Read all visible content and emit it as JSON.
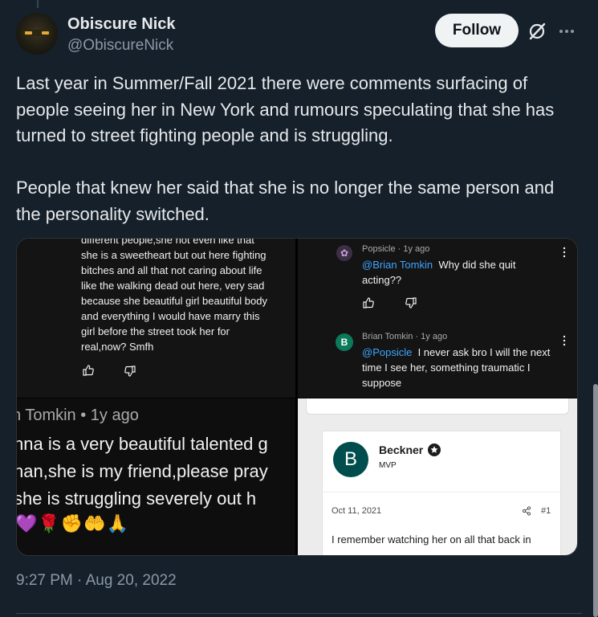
{
  "author": {
    "display_name": "Obiscure Nick",
    "handle": "@ObiscureNick",
    "avatar_icon": "masked-face-avatar"
  },
  "actions": {
    "follow_label": "Follow",
    "grok_icon": "grok-slash-icon",
    "more_icon": "more-dots-icon"
  },
  "tweet": {
    "text": "Last year in Summer/Fall 2021 there were comments surfacing of people seeing her in New York and rumours speculating that she has turned to street fighting people and is struggling.\n\nPeople that knew her said that she is no longer the same person and the personality switched.",
    "timestamp": "9:27 PM · Aug 20, 2022"
  },
  "media": {
    "top_left": {
      "comment_text": "different people,she not even like that\nshe is a sweetheart but out here fighting\nbitches and all that not caring about life\nlike the walking dead out here, very sad\nbecause she beautiful girl beautiful body\nand everything I would have marry this\ngirl before the street took her for\nreal,now? Smfh"
    },
    "top_right": {
      "c1_meta": "Popsicle · 1y ago",
      "c1_mention": "@Brian Tomkin",
      "c1_text": "  Why did she quit\nacting??",
      "c2_avatar": "B",
      "c2_meta": "Brian Tomkin · 1y ago",
      "c2_mention": "@Popsicle",
      "c2_text": "  I never ask bro I will the next\ntime I see her, something traumatic I\nsuppose"
    },
    "bottom_left": {
      "meta": "n Tomkin • 1y ago",
      "text": "nna is a very beautiful talented g\nnan,she is my friend,please pray\nshe is struggling severely out h",
      "emojis": "💜🌹✊🤲🙏"
    },
    "bottom_right": {
      "avatar": "B",
      "name": "Beckner",
      "role": "MVP",
      "date": "Oct 11, 2021",
      "post_number": "#1",
      "text": "I remember watching her on all that back in"
    }
  }
}
